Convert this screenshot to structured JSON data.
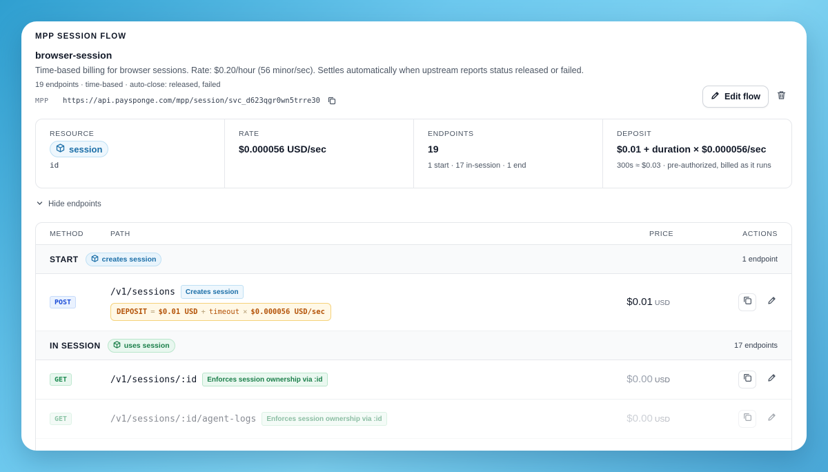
{
  "header": {
    "eyebrow": "MPP SESSION FLOW",
    "flow_name": "browser-session",
    "description": "Time-based billing for browser sessions. Rate: $0.20/hour (56 minor/sec). Settles automatically when upstream reports status released or failed.",
    "meta": "19 endpoints · time-based · auto-close: released, failed",
    "url_label": "MPP",
    "url": "https://api.paysponge.com/mpp/session/svc_d623qgr0wn5trre30",
    "copy_icon": "copy-icon",
    "edit_label": "Edit flow",
    "edit_icon": "pencil-icon",
    "delete_icon": "trash-icon"
  },
  "stats": {
    "resource": {
      "key": "RESOURCE",
      "pill": "session",
      "id": "id",
      "icon": "cube-icon"
    },
    "rate": {
      "key": "RATE",
      "value": "$0.000056 USD/sec"
    },
    "endpoints": {
      "key": "ENDPOINTS",
      "value": "19",
      "sub": "1 start · 17 in-session · 1 end"
    },
    "deposit": {
      "key": "DEPOSIT",
      "value": "$0.01 + duration × $0.000056/sec",
      "sub": "300s ≈ $0.03 · pre-authorized, billed as it runs"
    }
  },
  "toggle": {
    "label": "Hide endpoints",
    "icon": "chevron-down-icon"
  },
  "table": {
    "columns": {
      "method": "METHOD",
      "path": "PATH",
      "price": "PRICE",
      "actions": "ACTIONS"
    },
    "groups": [
      {
        "name": "START",
        "badge": "creates session",
        "count": "1 endpoint",
        "rows": [
          {
            "method": "POST",
            "path": "/v1/sessions",
            "tag": "Creates session",
            "formula": {
              "label": "DEPOSIT",
              "eq": "=",
              "base": "$0.01 USD",
              "plus": "+",
              "term": "timeout",
              "times": "×",
              "rate": "$0.000056 USD/sec"
            },
            "price": "$0.01",
            "currency": "USD"
          }
        ]
      },
      {
        "name": "IN SESSION",
        "badge": "uses session",
        "count": "17 endpoints",
        "rows": [
          {
            "method": "GET",
            "path": "/v1/sessions/:id",
            "tag": "Enforces session ownership via :id",
            "price": "$0.00",
            "currency": "USD"
          },
          {
            "method": "GET",
            "path": "/v1/sessions/:id/agent-logs",
            "tag": "Enforces session ownership via :id",
            "price": "$0.00",
            "currency": "USD"
          }
        ]
      }
    ]
  },
  "colors": {
    "accent_blue": "#1c6fa8",
    "accent_green": "#1b7f4a",
    "deposit_amber": "#b45309"
  }
}
